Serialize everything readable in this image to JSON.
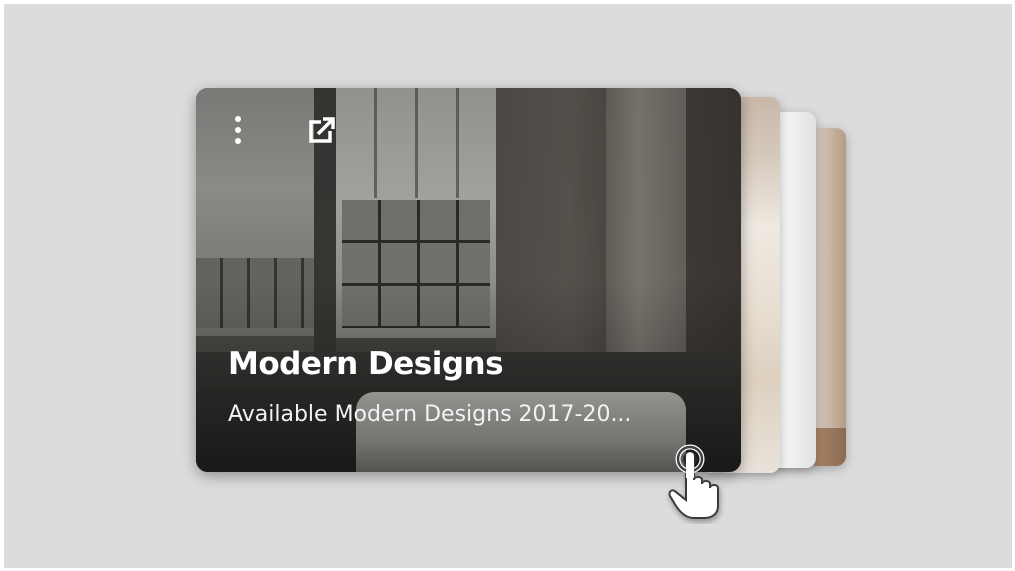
{
  "card": {
    "title": "Modern Designs",
    "subtitle": "Available Modern Designs 2017-20...",
    "more_icon": "more-vertical-icon",
    "open_icon": "open-external-icon"
  },
  "stack": {
    "count_behind": 3
  },
  "cursor": {
    "icon": "hand-pointer-icon"
  },
  "colors": {
    "background": "#dcdcdc",
    "text": "#ffffff"
  }
}
